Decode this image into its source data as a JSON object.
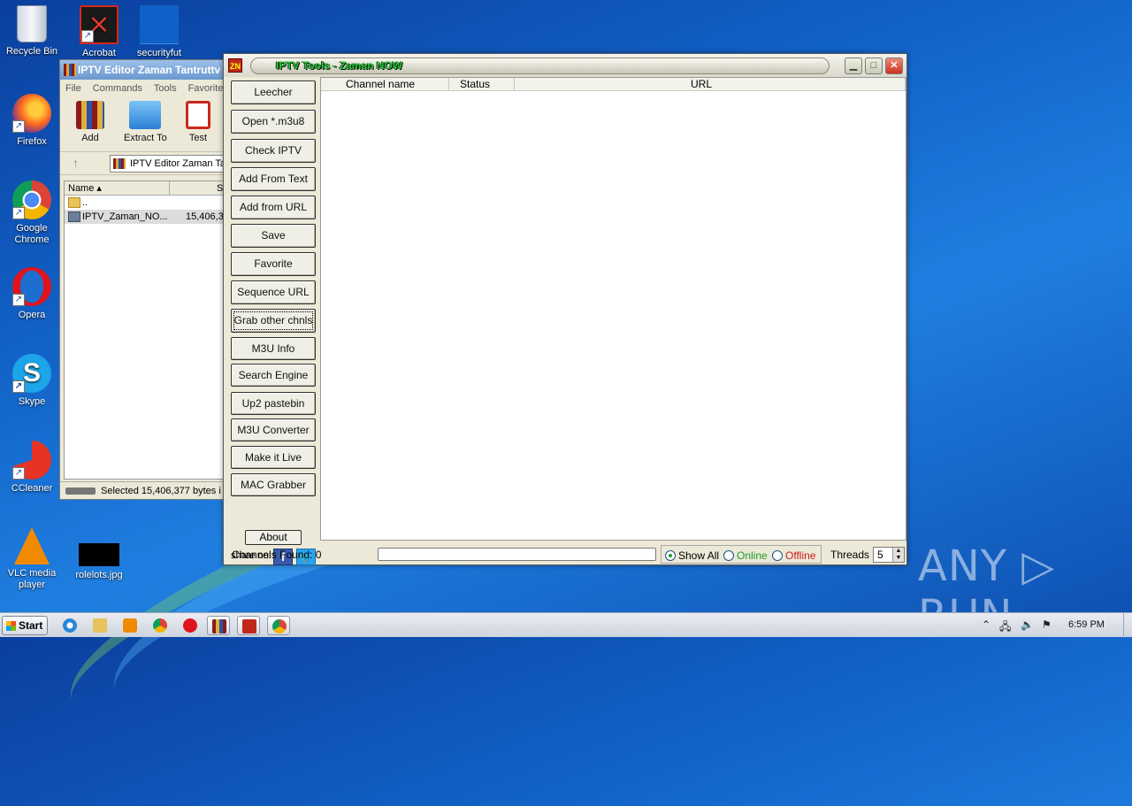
{
  "desktop": {
    "icons": [
      {
        "label": "Recycle Bin",
        "icon": "recycle-bin-icon"
      },
      {
        "label": "Acrobat",
        "icon": "acrobat-icon"
      },
      {
        "label": "securityfut",
        "icon": "file-icon"
      },
      {
        "label": "Firefox",
        "icon": "firefox-icon"
      },
      {
        "label": "Google Chrome",
        "icon": "chrome-icon"
      },
      {
        "label": "Opera",
        "icon": "opera-icon"
      },
      {
        "label": "Skype",
        "icon": "skype-icon"
      },
      {
        "label": "CCleaner",
        "icon": "ccleaner-icon"
      },
      {
        "label": "VLC media player",
        "icon": "vlc-icon"
      },
      {
        "label": "rolelots.jpg",
        "icon": "image-file-icon"
      }
    ]
  },
  "winrar": {
    "title": "IPTV Editor Zaman Tantruttv",
    "menu": [
      "File",
      "Commands",
      "Tools",
      "Favorites"
    ],
    "toolbar": [
      "Add",
      "Extract To",
      "Test"
    ],
    "address": "IPTV Editor Zaman Tar",
    "columns": {
      "name": "Name",
      "size": "S"
    },
    "rows": [
      {
        "name": "..",
        "size": ""
      },
      {
        "name": "IPTV_Zaman_NO...",
        "size": "15,406,3"
      }
    ],
    "status": "Selected 15,406,377 bytes i"
  },
  "iptv": {
    "title": "IPTV Tools  -  Zaman NOW",
    "buttons": [
      "Leecher",
      "Open *.m3u8",
      "Check IPTV",
      "Add From Text",
      "Add from URL",
      "Save",
      "Favorite",
      "Sequence URL",
      "Grab other  chnls",
      "M3U Info",
      "Search Engine",
      "Up2 pastebin",
      "M3U Converter",
      "Make it Live",
      "MAC  Grabber"
    ],
    "about": "About",
    "share_label": "share on:",
    "columns": {
      "channel": "Channel name",
      "status": "Status",
      "url": "URL"
    },
    "channels_found": "Channels Found: 0",
    "filters": {
      "all": "Show All",
      "online": "Online",
      "offline": "Offline",
      "selected": "Show All"
    },
    "threads_label": "Threads",
    "threads_value": "5"
  },
  "watermark": "ANY ▷ RUN",
  "taskbar": {
    "start": "Start",
    "clock": "6:59 PM",
    "apps": [
      "ie-icon",
      "explorer-icon",
      "media-player-icon",
      "chrome-icon",
      "opera-icon",
      "winrar-icon",
      "iptv-tools-icon",
      "chrome-icon"
    ]
  },
  "colors": {
    "online": "#1c9a2a",
    "offline": "#cc1a1a",
    "title_text": "#22cc33"
  }
}
